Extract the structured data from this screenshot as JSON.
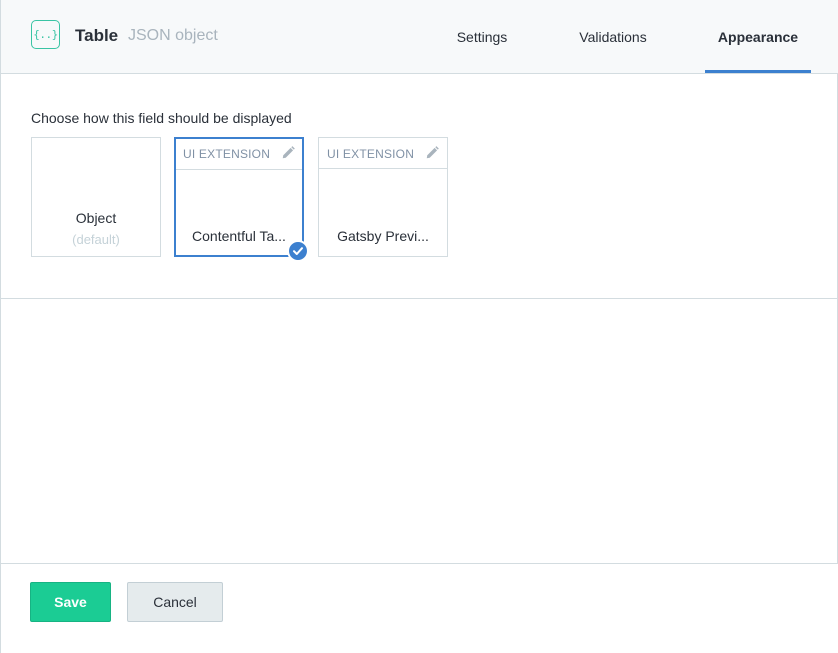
{
  "header": {
    "field_icon_glyph": "{..}",
    "field_name": "Table",
    "field_type": "JSON object",
    "tabs": [
      {
        "label": "Settings",
        "active": false
      },
      {
        "label": "Validations",
        "active": false
      },
      {
        "label": "Appearance",
        "active": true
      }
    ]
  },
  "appearance": {
    "prompt": "Choose how this field should be displayed",
    "widgets": [
      {
        "label": "Object",
        "sublabel": "(default)",
        "selected": false
      },
      {
        "tag": "UI EXTENSION",
        "label": "Contentful Ta...",
        "selected": true,
        "icon": "pencil-icon"
      },
      {
        "tag": "UI EXTENSION",
        "label": "Gatsby Previ...",
        "selected": false,
        "icon": "pencil-icon"
      }
    ]
  },
  "footer": {
    "save_label": "Save",
    "cancel_label": "Cancel"
  },
  "colors": {
    "accent": "#3c80cf",
    "primary_button": "#1bcc94",
    "field_icon": "#3ac4a4"
  }
}
